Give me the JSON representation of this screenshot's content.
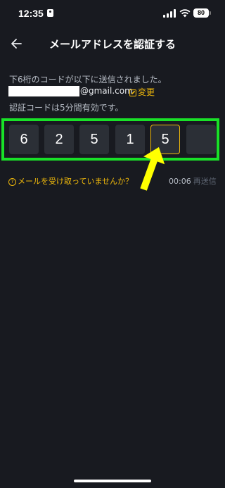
{
  "status_bar": {
    "time": "12:35",
    "battery": "80"
  },
  "header": {
    "title": "メールアドレスを認証する"
  },
  "content": {
    "line1": "下6桁のコードが以下に送信されました。",
    "email_domain": "@gmail.com",
    "change_label": "変更",
    "line2": "認証コードは5分間有効です。"
  },
  "code": {
    "digits": [
      "6",
      "2",
      "5",
      "1",
      "5",
      ""
    ]
  },
  "footer": {
    "no_mail_label": "メールを受け取っていませんか？",
    "timer": "00:06",
    "resend_label": "再送信"
  },
  "colors": {
    "background": "#181a20",
    "accent": "#f0b90b",
    "highlight": "#19e128",
    "annotation_arrow": "#ffff00"
  }
}
